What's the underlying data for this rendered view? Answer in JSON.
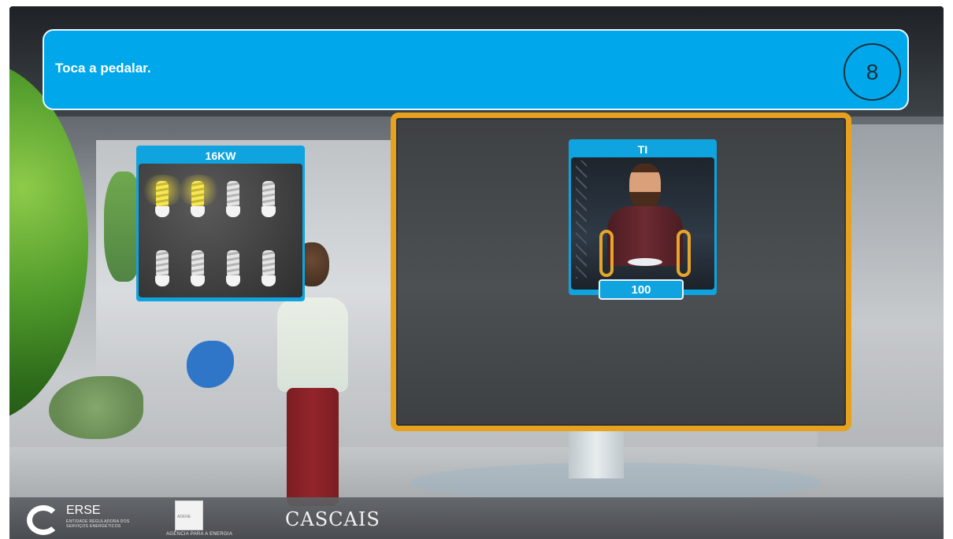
{
  "instruction": {
    "text": "Toca a pedalar.",
    "timer_value": "8"
  },
  "power_panel": {
    "title": "16KW",
    "bulbs_total": 8,
    "bulbs_lit": 2
  },
  "player_panel": {
    "name": "TI",
    "score": "100"
  },
  "footer": {
    "erse_name": "ERSE",
    "erse_subtitle": "ENTIDADE REGULADORA DOS SERVIÇOS ENERGÉTICOS",
    "adene_name": "ADENE",
    "adene_subtitle": "AGÊNCIA PARA A ENERGIA",
    "cascais": "CASCAIS"
  },
  "colors": {
    "banner": "#00a7ea",
    "card": "#0fa3df",
    "monitor_frame": "#e6a11e"
  }
}
